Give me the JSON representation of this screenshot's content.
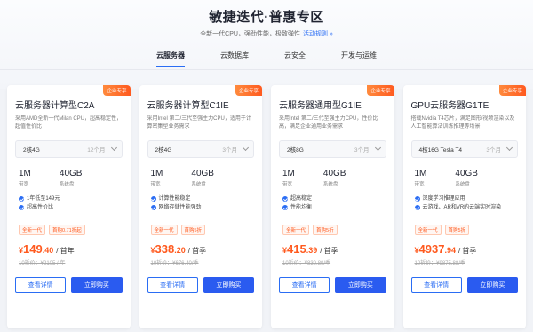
{
  "header": {
    "title": "敏捷迭代·普惠专区",
    "subtitle": "全新一代CPU，强劲性能，极致弹性",
    "activity_link": "活动规则 »"
  },
  "tabs": [
    {
      "label": "云服务器",
      "active": true
    },
    {
      "label": "云数据库",
      "active": false
    },
    {
      "label": "云安全",
      "active": false
    },
    {
      "label": "开发与运维",
      "active": false
    }
  ],
  "cards": [
    {
      "badge": "企业专享",
      "name": "云服务器计算型C2A",
      "desc": "采用AMD全新一代Milan CPU，超高稳定性，超值性价比",
      "config": "2核4G",
      "period": "12个月",
      "bandwidth": "1M",
      "bandwidth_label": "带宽",
      "disk": "40GB",
      "disk_label": "系统盘",
      "features": [
        "1年低至149元",
        "超高性价比"
      ],
      "tags": [
        "全新一代",
        "首购0.71折起"
      ],
      "price_cur": "¥",
      "price_int": "149",
      "price_dec": ".40",
      "per": "/ 首年",
      "orig": "10折价：¥2105 / 年",
      "detail_label": "查看详情",
      "buy_label": "立即购买"
    },
    {
      "badge": "企业专享",
      "name": "云服务器计算型C1IE",
      "desc": "采用Intel 第二/三代至强主力CPU，适用于计算密集型业务需求",
      "config": "2核4G",
      "period": "3个月",
      "bandwidth": "1M",
      "bandwidth_label": "带宽",
      "disk": "40GB",
      "disk_label": "系统盘",
      "features": [
        "计算性能稳定",
        "网络存储性能强劲"
      ],
      "tags": [
        "全新一代",
        "首购5折"
      ],
      "price_cur": "¥",
      "price_int": "338",
      "price_dec": ".20",
      "per": "/ 首季",
      "orig": "10折价：¥676.40/季",
      "detail_label": "查看详情",
      "buy_label": "立即购买"
    },
    {
      "badge": "企业专享",
      "name": "云服务器通用型G1IE",
      "desc": "采用Intel 第二/三代至强主力CPU，性价比高，满足企业通用业务需求",
      "config": "2核8G",
      "period": "3个月",
      "bandwidth": "1M",
      "bandwidth_label": "带宽",
      "disk": "40GB",
      "disk_label": "系统盘",
      "features": [
        "超高稳定",
        "性能均衡"
      ],
      "tags": [
        "全新一代",
        "首购5折"
      ],
      "price_cur": "¥",
      "price_int": "415",
      "price_dec": ".39",
      "per": "/ 首季",
      "orig": "10折价：¥830.80/季",
      "detail_label": "查看详情",
      "buy_label": "立即购买"
    },
    {
      "badge": "企业专享",
      "name": "GPU云服务器G1TE",
      "desc": "搭载Nvidia T4芯片，满足图形/视频渲染以及人工智能算法训练推理等场景",
      "config": "4核16G Tesla T4",
      "period": "3个月",
      "bandwidth": "1M",
      "bandwidth_label": "带宽",
      "disk": "40GB",
      "disk_label": "系统盘",
      "features": [
        "深度学习推理应用",
        "云游戏、AR和VR的云端实时渲染"
      ],
      "tags": [
        "全新一代",
        "首购5折"
      ],
      "price_cur": "¥",
      "price_int": "4937",
      "price_dec": ".94",
      "per": "/ 首季",
      "orig": "10折价：¥9875.88/季",
      "detail_label": "查看详情",
      "buy_label": "立即购买"
    }
  ]
}
